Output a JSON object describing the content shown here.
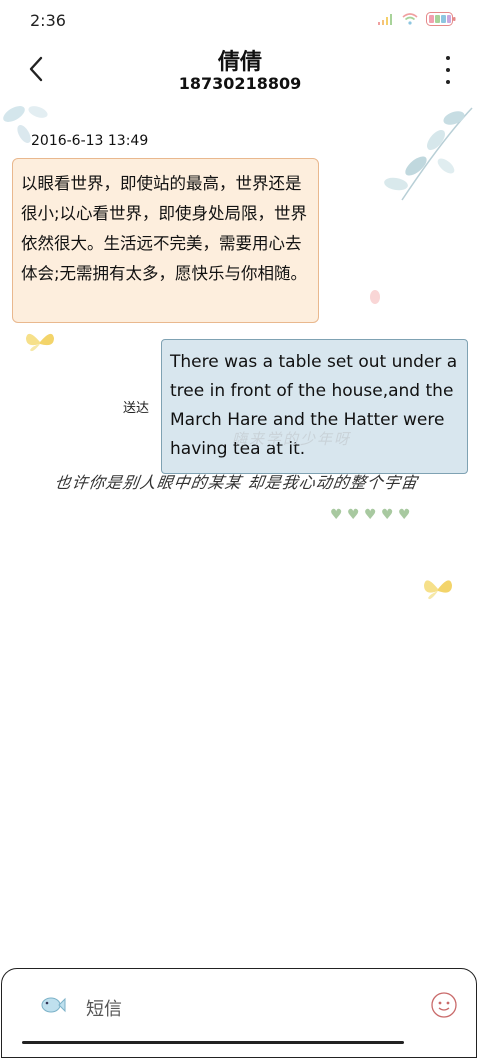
{
  "status_bar": {
    "time": "2:36"
  },
  "header": {
    "title": "倩倩",
    "subtitle": "18730218809"
  },
  "conversation": {
    "timestamp": "2016-6-13 13:49",
    "incoming_text": "以眼看世界，即使站的最高，世界还是很小;以心看世界，即使身处局限，世界依然很大。生活远不完美，需要用心去体会;无需拥有太多，愿快乐与你相随。",
    "outgoing_text": "There was a table set out under a tree in front of the house,and the March Hare and the Hatter were having tea at it.",
    "sent_status": "送达"
  },
  "decorations": {
    "watermark": "嗨来学的少年呀",
    "motto": "也许你是别人眼中的某某 却是我心动的整个宇宙",
    "hearts": "♥ ♥ ♥ ♥ ♥"
  },
  "composer": {
    "placeholder": "短信"
  },
  "colors": {
    "incoming_bg": "#fdeedd",
    "incoming_border": "#e9b88e",
    "outgoing_bg": "#d8e6ee",
    "outgoing_border": "#7fa2b3"
  }
}
